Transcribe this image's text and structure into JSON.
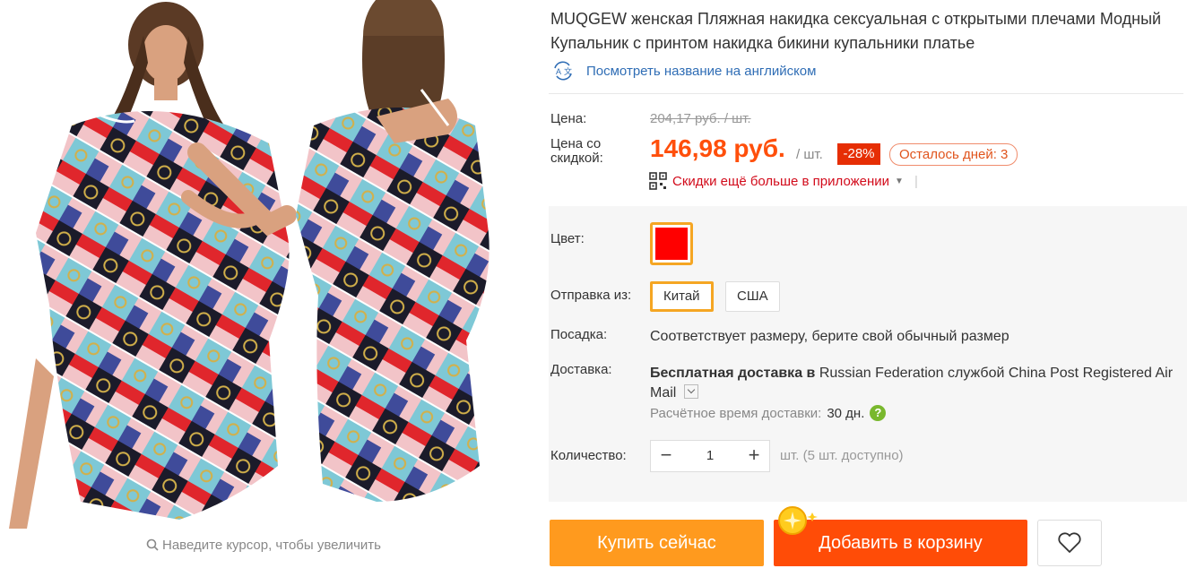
{
  "gallery": {
    "zoom_hint": "Наведите курсор, чтобы увеличить"
  },
  "product": {
    "title": "MUQGEW женская Пляжная накидка сексуальная с открытыми плечами Модный Купальник с принтом накидка бикини купальники платье",
    "translate_link": "Посмотреть название на английском"
  },
  "pricing": {
    "price_label": "Цена:",
    "old_price": "204,17 руб. / шт.",
    "discount_price_label": "Цена со скидкой:",
    "price": "146,98 руб.",
    "per_unit": "/ шт.",
    "discount_badge": "-28%",
    "days_left": "Осталось дней: 3",
    "app_promo": "Скидки ещё больше в приложении"
  },
  "options": {
    "color_label": "Цвет:",
    "color_value": "#ff0000",
    "ship_from_label": "Отправка из:",
    "ship_from": [
      "Китай",
      "США"
    ],
    "fit_label": "Посадка:",
    "fit_value": "Соответствует размеру, берите свой обычный размер",
    "delivery_label": "Доставка:",
    "delivery_bold": "Бесплатная доставка в",
    "delivery_rest": "Russian Federation службой China Post Registered Air Mail",
    "eta_label": "Расчётное время доставки:",
    "eta_days": "30 дн.",
    "quantity_label": "Количество:",
    "quantity": "1",
    "stock": "шт. (5 шт. доступно)"
  },
  "actions": {
    "buy_now": "Купить сейчас",
    "add_to_cart": "Добавить в корзину"
  },
  "colors": {
    "price": "#ff4f0b",
    "buy_now": "#ff9a1e",
    "add_to_cart": "#ff4c07",
    "selected_border": "#f5a623"
  }
}
